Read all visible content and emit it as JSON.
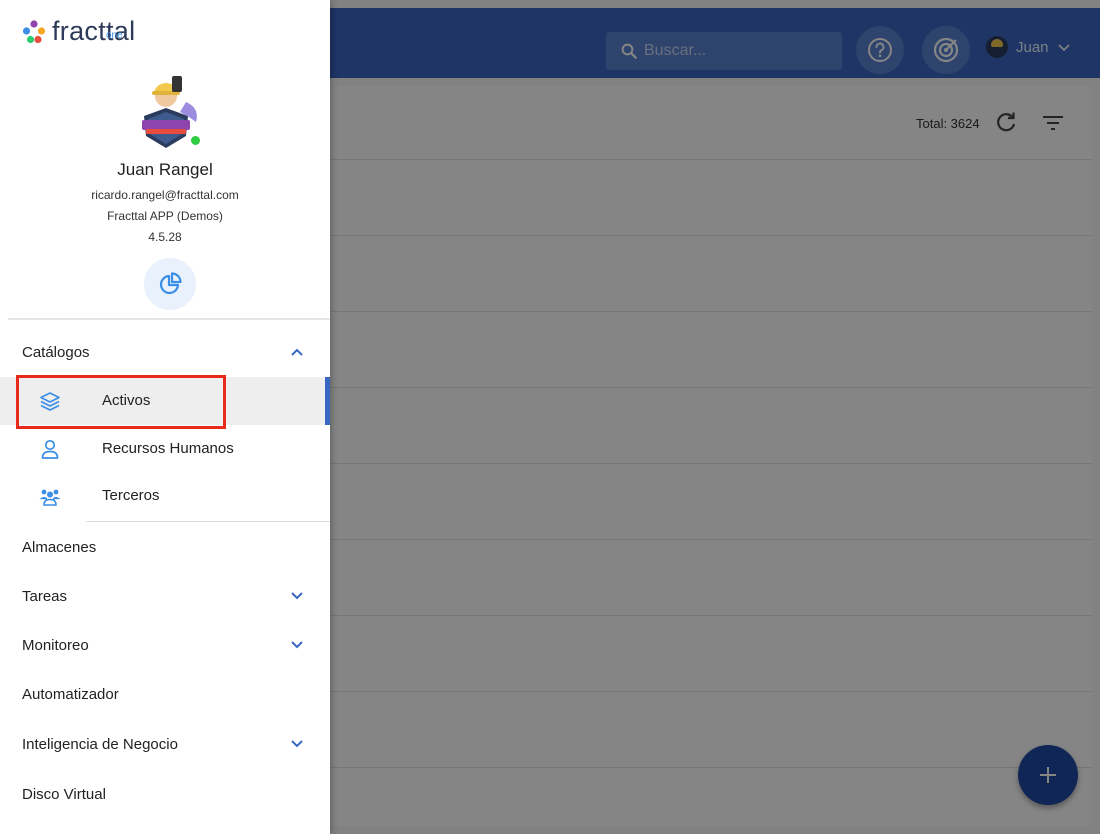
{
  "header": {
    "search": {
      "placeholder": "Buscar..."
    },
    "user_menu": {
      "name": "Juan"
    }
  },
  "list": {
    "total_label": "Total: 3624"
  },
  "drawer": {
    "logo": {
      "word": "fracttal",
      "sub": "one"
    },
    "profile": {
      "name": "Juan Rangel",
      "email": "ricardo.rangel@fracttal.com",
      "organization": "Fracttal APP (Demos)",
      "version": "4.5.28"
    },
    "menu": {
      "catalogos": {
        "label": "Catálogos",
        "expanded": true
      },
      "catalogos_items": [
        {
          "label": "Activos",
          "icon": "layers-icon",
          "active": true
        },
        {
          "label": "Recursos Humanos",
          "icon": "person-icon",
          "active": false
        },
        {
          "label": "Terceros",
          "icon": "group-icon",
          "active": false
        }
      ],
      "almacenes": {
        "label": "Almacenes"
      },
      "tareas": {
        "label": "Tareas"
      },
      "monitoreo": {
        "label": "Monitoreo"
      },
      "automatizador": {
        "label": "Automatizador"
      },
      "inteligencia": {
        "label": "Inteligencia de Negocio"
      },
      "disco": {
        "label": "Disco Virtual"
      }
    }
  },
  "colors": {
    "primary": "#3a67c4",
    "fab": "#1e4aa8",
    "accent_icon": "#3a8ee6",
    "highlight": "#e8291c",
    "online": "#2ecc40"
  }
}
